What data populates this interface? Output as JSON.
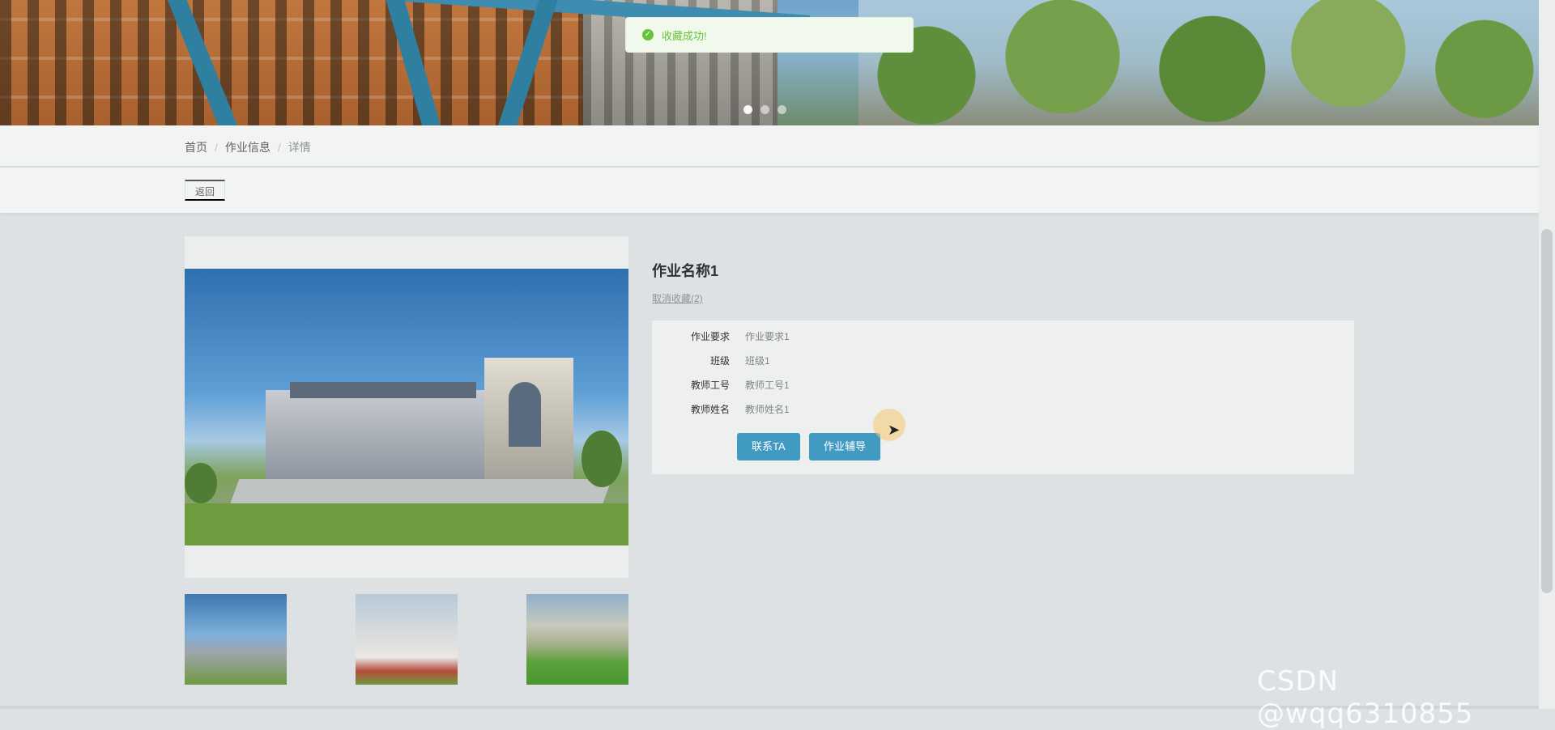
{
  "toast": {
    "message": "收藏成功!",
    "icon": "check-circle-icon"
  },
  "carousel": {
    "slides": 3,
    "active_index": 1
  },
  "breadcrumb": {
    "items": [
      "首页",
      "作业信息",
      "详情"
    ],
    "separator": "/"
  },
  "toolbar": {
    "back_label": "返回"
  },
  "detail": {
    "title": "作业名称1",
    "favorite_label": "取消收藏(2)",
    "fields": [
      {
        "label": "作业要求",
        "value": "作业要求1"
      },
      {
        "label": "班级",
        "value": "班级1"
      },
      {
        "label": "教师工号",
        "value": "教师工号1"
      },
      {
        "label": "教师姓名",
        "value": "教师姓名1"
      }
    ],
    "buttons": {
      "contact": "联系TA",
      "tutoring": "作业辅导"
    }
  },
  "gallery": {
    "thumbnail_count": 3
  },
  "watermark": "CSDN @wqq6310855",
  "colors": {
    "primary_button": "#419ac1",
    "toast_success": "#67c23a",
    "page_bg": "#dde1e3"
  }
}
